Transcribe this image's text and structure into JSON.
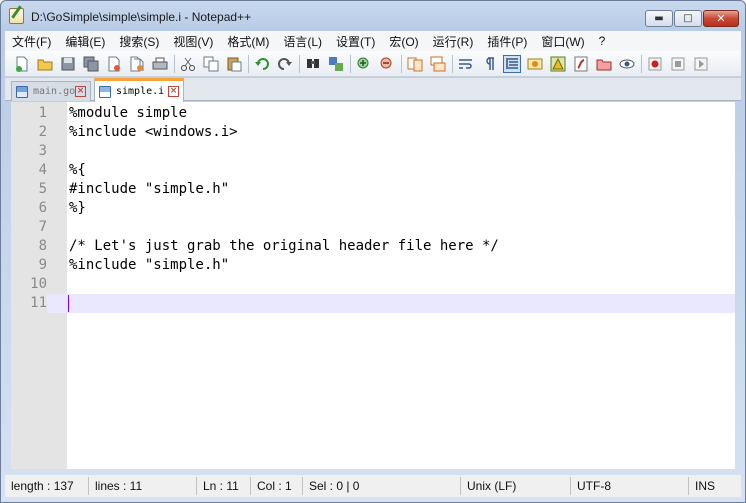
{
  "window": {
    "title": "D:\\GoSimple\\simple\\simple.i - Notepad++",
    "minimize_glyph": "▬",
    "maximize_glyph": "□",
    "close_glyph": "✕"
  },
  "menu": [
    "文件(F)",
    "编辑(E)",
    "搜索(S)",
    "视图(V)",
    "格式(M)",
    "语言(L)",
    "设置(T)",
    "宏(O)",
    "运行(R)",
    "插件(P)",
    "窗口(W)",
    "?"
  ],
  "toolbar": {
    "icons": [
      "new-file-icon",
      "open-file-icon",
      "save-icon",
      "save-all-icon",
      "close-icon",
      "close-all-icon",
      "print-icon",
      "cut-icon",
      "copy-icon",
      "paste-icon",
      "undo-icon",
      "redo-icon",
      "find-icon",
      "replace-icon",
      "zoom-in-icon",
      "zoom-out-icon",
      "sync-vertical-icon",
      "sync-horizontal-icon",
      "word-wrap-icon",
      "show-all-chars-icon",
      "indent-guide-icon",
      "user-defined-lang-icon",
      "doc-map-icon",
      "function-list-icon",
      "folder-as-workspace-icon",
      "monitoring-icon",
      "record-macro-icon",
      "stop-record-icon",
      "play-macro-icon"
    ]
  },
  "tabs": [
    {
      "label": "main.go",
      "active": false
    },
    {
      "label": "simple.i",
      "active": true
    }
  ],
  "editor": {
    "lines": [
      {
        "n": "1",
        "text": "%module simple"
      },
      {
        "n": "2",
        "text": "%include <windows.i>"
      },
      {
        "n": "3",
        "text": ""
      },
      {
        "n": "4",
        "text": "%{"
      },
      {
        "n": "5",
        "text": "#include \"simple.h\""
      },
      {
        "n": "6",
        "text": "%}"
      },
      {
        "n": "7",
        "text": ""
      },
      {
        "n": "8",
        "text": "/* Let's just grab the original header file here */"
      },
      {
        "n": "9",
        "text": "%include \"simple.h\""
      },
      {
        "n": "10",
        "text": ""
      },
      {
        "n": "11",
        "text": ""
      }
    ],
    "current_line": 11
  },
  "status": {
    "length": "length : 137",
    "lines": "lines : 11",
    "ln": "Ln : 11",
    "col": "Col : 1",
    "sel": "Sel : 0 | 0",
    "eol": "Unix (LF)",
    "encoding": "UTF-8",
    "mode": "INS"
  },
  "colors": {
    "tab_accent": "#f6a33c",
    "current_line_bg": "#e8e8ff",
    "caret": "#8000ff",
    "gutter_bg": "#e4e4e4"
  }
}
